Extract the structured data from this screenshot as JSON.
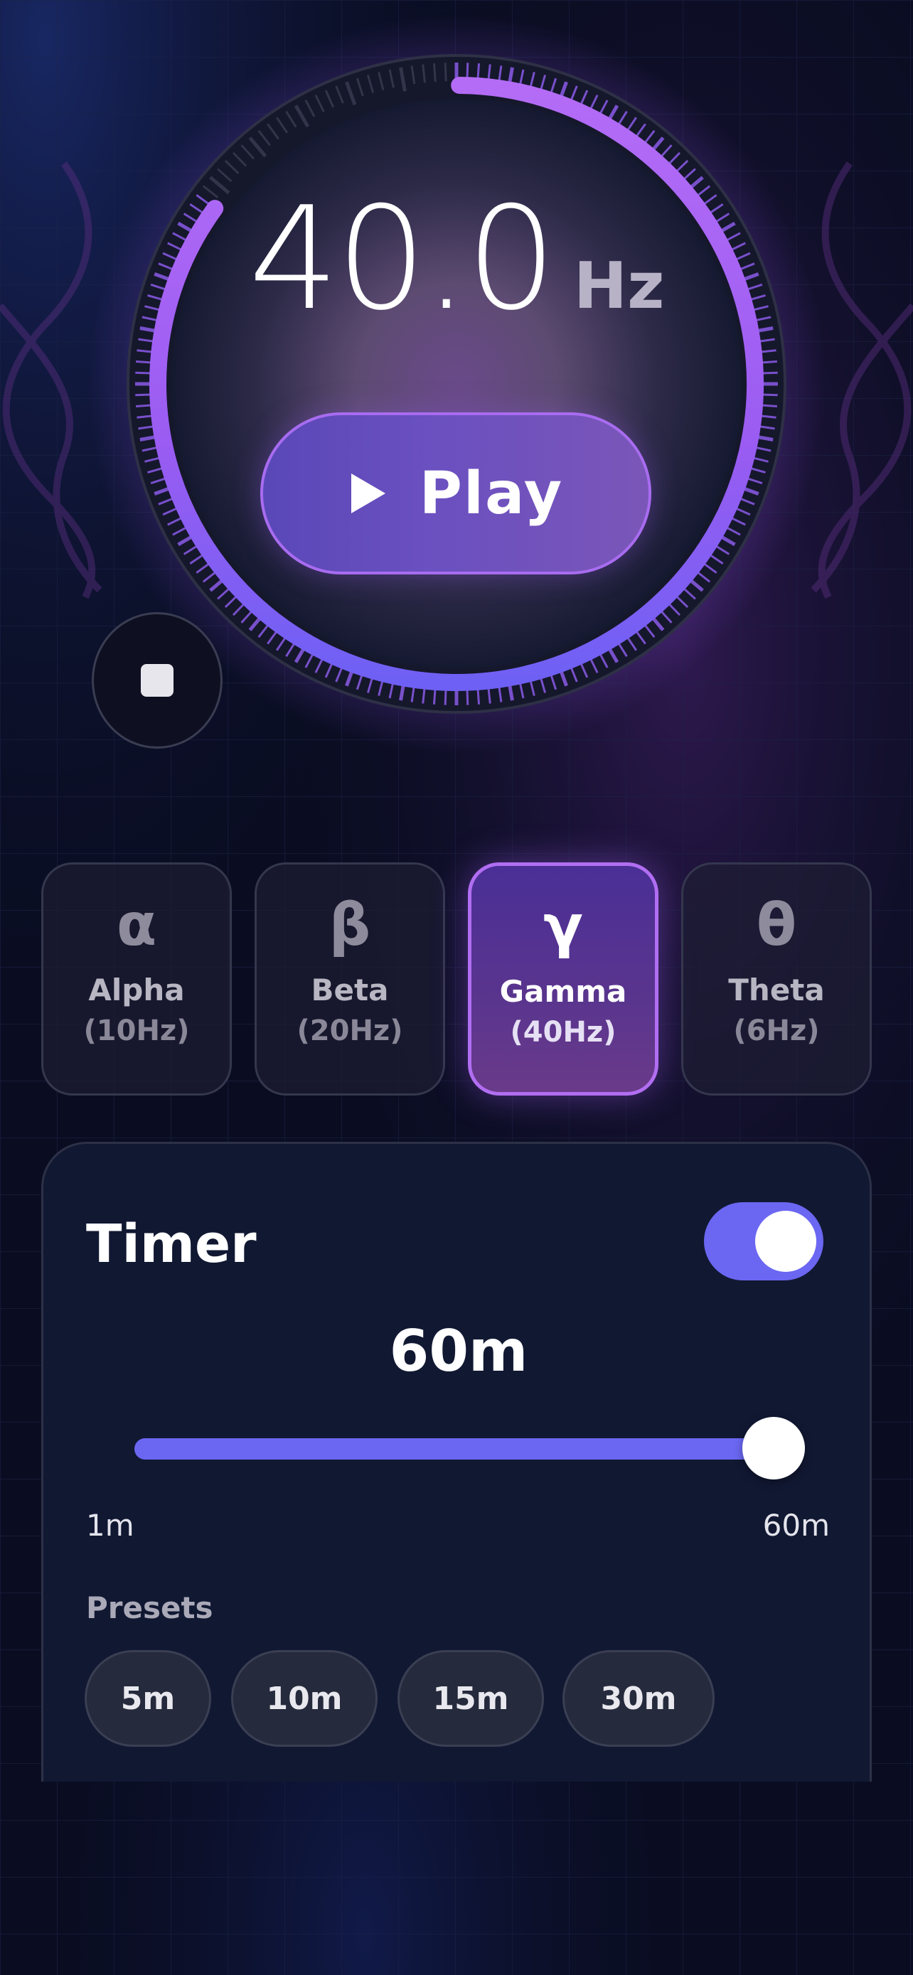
{
  "frequency": {
    "value": "40.0",
    "unit": "Hz"
  },
  "dial": {
    "progress": 0.85
  },
  "controls": {
    "play_label": "Play"
  },
  "waves": [
    {
      "symbol": "α",
      "name": "Alpha",
      "freq": "(10Hz)",
      "active": false
    },
    {
      "symbol": "β",
      "name": "Beta",
      "freq": "(20Hz)",
      "active": false
    },
    {
      "symbol": "γ",
      "name": "Gamma",
      "freq": "(40Hz)",
      "active": true
    },
    {
      "symbol": "θ",
      "name": "Theta",
      "freq": "(6Hz)",
      "active": false
    }
  ],
  "timer": {
    "title": "Timer",
    "enabled": true,
    "value": "60m",
    "slider": {
      "min_label": "1m",
      "max_label": "60m",
      "fraction": 1.0
    },
    "presets_label": "Presets",
    "presets": [
      "5m",
      "10m",
      "15m",
      "30m"
    ]
  },
  "colors": {
    "accent": "#6b67f2",
    "accent_purple": "#b16ef2",
    "background": "#0b0e24"
  }
}
